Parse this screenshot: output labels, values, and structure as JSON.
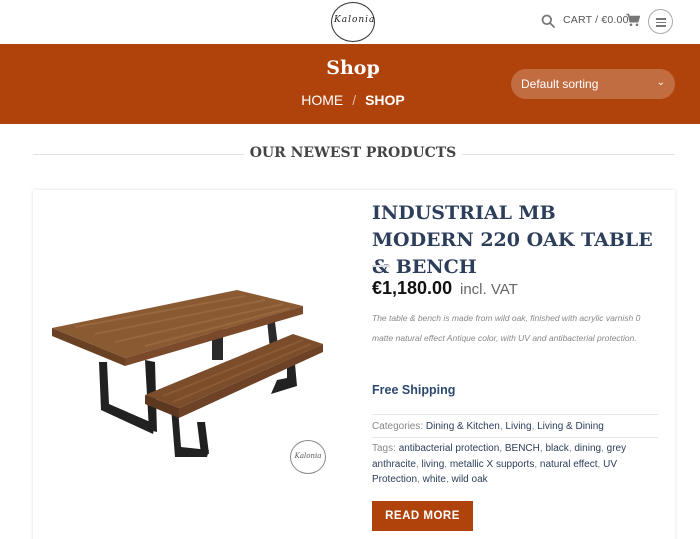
{
  "header": {
    "logo_text": "Kalonia",
    "cart_label": "CART / €0.00",
    "search_icon": "search-icon",
    "cart_icon": "cart-icon",
    "menu_icon": "hamburger-menu-icon"
  },
  "banner": {
    "title": "Shop",
    "breadcrumb": [
      "HOME",
      "SHOP"
    ],
    "breadcrumb_separator": "/",
    "sort_selected": "Default sorting",
    "background_color": "#b0430c"
  },
  "section": {
    "title": "OUR NEWEST PRODUCTS"
  },
  "product": {
    "title": "INDUSTRIAL MB MODERN 220 OAK TABLE & BENCH",
    "price": "€1,180.00",
    "vat_label": "incl. VAT",
    "description": "The table & bench is made from wild oak, finished with acrylic varnish 0 matte natural effect Antique color, with UV and antibacterial protection.",
    "shipping": "Free Shipping",
    "categories_label": "Categories:",
    "categories": [
      "Dining & Kitchen",
      "Living",
      "Living & Dining"
    ],
    "tags_label": "Tags:",
    "tags": [
      "antibacterial protection",
      "BENCH",
      "black",
      "dining",
      "grey anthracite",
      "living",
      "metallic X supports",
      "natural effect",
      "UV Protection",
      "white",
      "wild oak"
    ],
    "watermark_text": "Kalonia",
    "read_more_label": "READ MORE"
  }
}
